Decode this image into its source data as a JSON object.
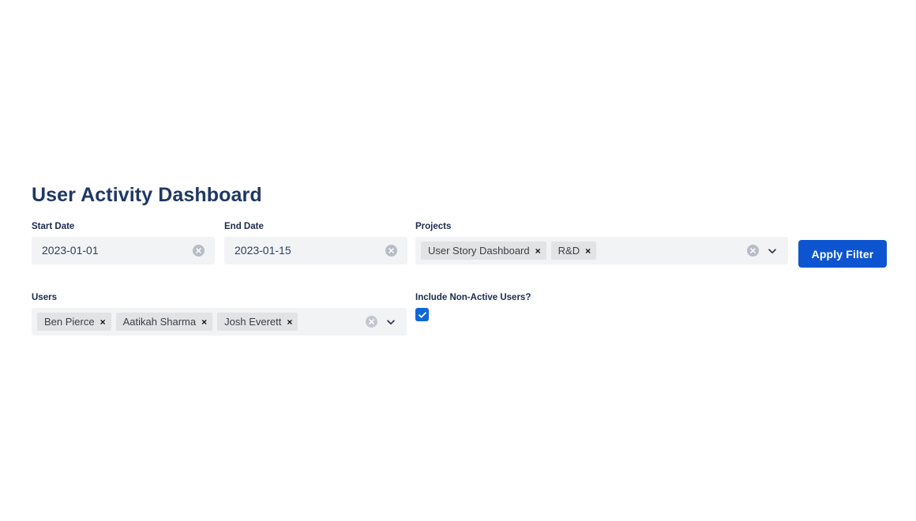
{
  "page": {
    "title": "User Activity Dashboard",
    "accent_color": "#0d55d0",
    "title_color": "#1f3864",
    "label_color": "#1b2a4e",
    "field_bg_color": "#f2f3f5",
    "chip_bg_color": "#e2e3e5"
  },
  "filters": {
    "start_date": {
      "label": "Start Date",
      "value": "2023-01-01",
      "placeholder": "",
      "clear_icon": "clear-circle-icon"
    },
    "end_date": {
      "label": "End Date",
      "value": "2023-01-15",
      "placeholder": "",
      "clear_icon": "clear-circle-icon"
    },
    "projects": {
      "label": "Projects",
      "placeholder": "",
      "selected": [
        {
          "label": "User Story Dashboard",
          "remove": "×"
        },
        {
          "label": "R&D",
          "remove": "×"
        }
      ],
      "clear_icon": "clear-circle-icon",
      "dropdown_icon": "chevron-down-icon"
    },
    "users": {
      "label": "Users",
      "placeholder": "",
      "selected": [
        {
          "label": "Ben Pierce",
          "remove": "×"
        },
        {
          "label": "Aatikah Sharma",
          "remove": "×"
        },
        {
          "label": "Josh Everett",
          "remove": "×"
        }
      ],
      "clear_icon": "clear-circle-icon",
      "dropdown_icon": "chevron-down-icon"
    },
    "include_non_active": {
      "label": "Include Non-Active Users?",
      "checked": true,
      "check_glyph": "✔"
    },
    "apply_button": {
      "label": "Apply Filter"
    }
  }
}
